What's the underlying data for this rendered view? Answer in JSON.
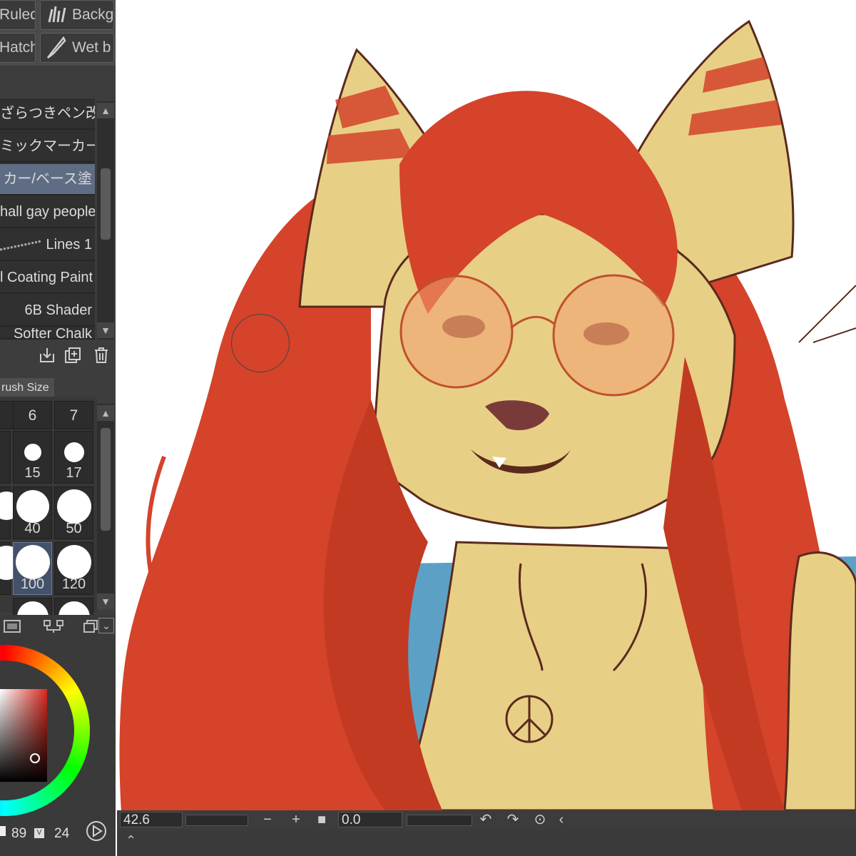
{
  "tool_buttons": [
    {
      "label": "Ruled",
      "icon": "ruler-icon"
    },
    {
      "label": "Backg",
      "icon": "grass-icon"
    },
    {
      "label": "Hatch",
      "icon": "hatch-icon"
    },
    {
      "label": "Wet b",
      "icon": "wet-brush-icon"
    }
  ],
  "brush_list": [
    {
      "label": "ざらつきペン改"
    },
    {
      "label": "ミックマーカー四"
    },
    {
      "label": "カー/ベース塗",
      "selected": true
    },
    {
      "label": "hall gay people"
    },
    {
      "label": "Lines 1"
    },
    {
      "label": "l Coating Paint"
    },
    {
      "label": "6B Shader"
    },
    {
      "label": "Softer Chalk"
    }
  ],
  "brush_size_panel": {
    "tab_label": "rush Size",
    "headers": [
      "6",
      "7"
    ],
    "rows": [
      [
        "15",
        "17"
      ],
      [
        "40",
        "50"
      ],
      [
        "100",
        "120"
      ]
    ],
    "selected": "100"
  },
  "color_panel": {
    "values": [
      "89",
      "24"
    ],
    "hue_color": "#d8281d"
  },
  "status": {
    "zoom": "42.6",
    "rotation": "0.0",
    "minus": "−",
    "plus": "+"
  },
  "colors": {
    "panel_bg": "#3d3d3d",
    "selection": "#5f6d84",
    "hair": "#d4432a",
    "fur": "#e8cf86",
    "outline": "#5a2a1c",
    "shirt": "#5da0c6"
  }
}
